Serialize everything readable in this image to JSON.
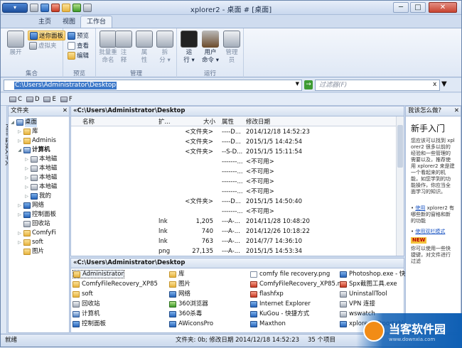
{
  "window": {
    "title": "xplorer2 - 桌面 # [桌面]",
    "minimize": "─",
    "maximize": "□",
    "close": "✕"
  },
  "app_button": "▾",
  "tabs": [
    "主页",
    "视图",
    "工作台"
  ],
  "ribbon": {
    "groups": [
      "集合",
      "预览",
      "管理",
      "运行"
    ],
    "expand": "展开",
    "mini_panel": "迷你面板",
    "virtual_folder": "虚拟夹",
    "preview": "预览",
    "view": "查看",
    "edit": "编辑",
    "batch_rename": "批量重\n命名",
    "comment": "注\n释",
    "properties": "属\n性",
    "split": "拆\n分 ▾",
    "run": "运\n行 ▾",
    "user_cmd": "用户\n命令 ▾",
    "admin": "管理\n员"
  },
  "address": {
    "path": "C:\\Users\\Administrator\\Desktop",
    "filter_placeholder": "过滤器(F)",
    "clear": "x",
    "go": "→"
  },
  "drives": [
    "C",
    "D",
    "E",
    "F"
  ],
  "tree": {
    "header": "文件夹",
    "pin": "📌",
    "sidebar_label": "Mini 虚拟文件夹",
    "nodes": [
      {
        "label": "桌面",
        "level": 0,
        "toggle": "◢",
        "icon": "pc",
        "sel": true
      },
      {
        "label": "库",
        "level": 1,
        "toggle": "▷",
        "icon": "folder"
      },
      {
        "label": "Adminis",
        "level": 1,
        "toggle": "▷",
        "icon": "folder"
      },
      {
        "label": "计算机",
        "level": 1,
        "toggle": "◢",
        "icon": "pc",
        "bold": true
      },
      {
        "label": "本地磁",
        "level": 2,
        "toggle": "▷",
        "icon": "gray"
      },
      {
        "label": "本地磁",
        "level": 2,
        "toggle": "▷",
        "icon": "gray"
      },
      {
        "label": "本地磁",
        "level": 2,
        "toggle": "▷",
        "icon": "gray"
      },
      {
        "label": "本地磁",
        "level": 2,
        "toggle": "▷",
        "icon": "gray"
      },
      {
        "label": "我的",
        "level": 2,
        "toggle": "▷",
        "icon": "blue"
      },
      {
        "label": "网络",
        "level": 1,
        "toggle": "▷",
        "icon": "blue"
      },
      {
        "label": "控制面板",
        "level": 1,
        "toggle": "▷",
        "icon": "blue"
      },
      {
        "label": "回收站",
        "level": 1,
        "toggle": "",
        "icon": "gray"
      },
      {
        "label": "ComfyFi",
        "level": 1,
        "toggle": "▷",
        "icon": "folder"
      },
      {
        "label": "soft",
        "level": 1,
        "toggle": "▷",
        "icon": "folder"
      },
      {
        "label": "图片",
        "level": 1,
        "toggle": "",
        "icon": "folder"
      }
    ]
  },
  "list": {
    "header": "«C:\\Users\\Administrator\\Desktop",
    "columns": [
      "名称",
      "扩...",
      "大小",
      "属性",
      "修改日期"
    ],
    "rows": [
      {
        "name": "Administrator",
        "ext": "",
        "size": "<文件夹>",
        "attr": "----D...",
        "date": "2014/12/18 14:52:23",
        "icon": "folder"
      },
      {
        "name": "ComfyFileRecovery_XP85",
        "ext": "",
        "size": "<文件夹>",
        "attr": "----D...",
        "date": "2015/1/5 14:42:54",
        "icon": "folder"
      },
      {
        "name": "soft",
        "ext": "",
        "size": "<文件夹>",
        "attr": "--S-D...",
        "date": "2015/1/5 15:11:54",
        "icon": "folder"
      },
      {
        "name": "回收站",
        "ext": "",
        "size": "",
        "attr": "-------...",
        "date": "<不可用>",
        "icon": "gray"
      },
      {
        "name": "计算机",
        "ext": "",
        "size": "",
        "attr": "-------...",
        "date": "<不可用>",
        "icon": "pc"
      },
      {
        "name": "控制面板",
        "ext": "",
        "size": "",
        "attr": "-------...",
        "date": "<不可用>",
        "icon": "blue"
      },
      {
        "name": "库",
        "ext": "",
        "size": "",
        "attr": "-------...",
        "date": "<不可用>",
        "icon": "folder"
      },
      {
        "name": "图片",
        "ext": "",
        "size": "<文件夹>",
        "attr": "----D...",
        "date": "2015/1/5 14:50:40",
        "icon": "folder"
      },
      {
        "name": "网络",
        "ext": "",
        "size": "",
        "attr": "-------...",
        "date": "<不可用>",
        "icon": "blue"
      },
      {
        "name": "360浏览器",
        "ext": "lnk",
        "size": "1,205",
        "attr": "---A-...",
        "date": "2014/11/28 10:48:20",
        "icon": "green"
      },
      {
        "name": "360杀毒",
        "ext": "lnk",
        "size": "740",
        "attr": "---A-...",
        "date": "2014/12/26 10:18:22",
        "icon": "blue"
      },
      {
        "name": "AWiconsPro",
        "ext": "lnk",
        "size": "763",
        "attr": "---A-...",
        "date": "2014/7/7 14:36:10",
        "icon": "blue"
      },
      {
        "name": "comfy file recovery.png",
        "ext": "png",
        "size": "27,135",
        "attr": "---A-...",
        "date": "2015/1/5 14:53:34",
        "icon": "doc"
      }
    ]
  },
  "list2": {
    "header": "«C:\\Users\\Administrator\\Desktop",
    "items": [
      {
        "label": "Administrator",
        "icon": "folder",
        "col": 0,
        "row": 0,
        "sel": true
      },
      {
        "label": "ComfyFileRecovery_XP85",
        "icon": "folder",
        "col": 0,
        "row": 1
      },
      {
        "label": "soft",
        "icon": "folder",
        "col": 0,
        "row": 2
      },
      {
        "label": "回收站",
        "icon": "gray",
        "col": 0,
        "row": 3
      },
      {
        "label": "计算机",
        "icon": "pc",
        "col": 0,
        "row": 4
      },
      {
        "label": "控制面板",
        "icon": "blue",
        "col": 0,
        "row": 5
      },
      {
        "label": "库",
        "icon": "folder",
        "col": 1,
        "row": 0
      },
      {
        "label": "图片",
        "icon": "folder",
        "col": 1,
        "row": 1
      },
      {
        "label": "网络",
        "icon": "blue",
        "col": 1,
        "row": 2
      },
      {
        "label": "360浏览器",
        "icon": "green",
        "col": 1,
        "row": 3
      },
      {
        "label": "360杀毒",
        "icon": "blue",
        "col": 1,
        "row": 4
      },
      {
        "label": "AWiconsPro",
        "icon": "blue",
        "col": 1,
        "row": 5
      },
      {
        "label": "comfy file recovery.png",
        "icon": "doc",
        "col": 2,
        "row": 0
      },
      {
        "label": "ComfyFileRecovery_XP85.rar",
        "icon": "red",
        "col": 2,
        "row": 1
      },
      {
        "label": "flashfxp",
        "icon": "red",
        "col": 2,
        "row": 2
      },
      {
        "label": "Internet Explorer",
        "icon": "blue",
        "col": 2,
        "row": 3
      },
      {
        "label": "KuGou - 快捷方式",
        "icon": "blue",
        "col": 2,
        "row": 4
      },
      {
        "label": "Maxthon",
        "icon": "blue",
        "col": 2,
        "row": 5
      },
      {
        "label": "Photoshop.exe - 快捷",
        "icon": "blue",
        "col": 3,
        "row": 0
      },
      {
        "label": "Spx截图工具.exe",
        "icon": "red",
        "col": 3,
        "row": 1
      },
      {
        "label": "UninstallTool",
        "icon": "gray",
        "col": 3,
        "row": 2
      },
      {
        "label": "VPN 连接",
        "icon": "gray",
        "col": 3,
        "row": 3
      },
      {
        "label": "wswatch",
        "icon": "gray",
        "col": 3,
        "row": 4
      },
      {
        "label": "xplorer2ultportable.",
        "icon": "blue",
        "col": 3,
        "row": 5
      }
    ]
  },
  "help": {
    "header": "我该怎么做?",
    "title": "新手入门",
    "body_a": "您应该可以找到 xplorer2 很多以前的经验和一些管理的需要以及，推荐使用 xplorer2 来是建一个看起来的机能，如您学到的功能操作，你应当全面学习的知识。",
    "link_a": "使用",
    "body_b": "xplorer2 有哪些新的窗格和新的功能",
    "link_b": "使用双栏模式",
    "badge": "NEW",
    "body_c": "你可以使用一些快捷键，对文件进行过滤"
  },
  "status": {
    "ready": "就绪",
    "info": "文件夹: 0b; 修改日期 2014/12/18 14:52:23",
    "count": "35 个项目"
  },
  "watermark": {
    "title": "当客软件园",
    "url": "www.downxia.com"
  }
}
